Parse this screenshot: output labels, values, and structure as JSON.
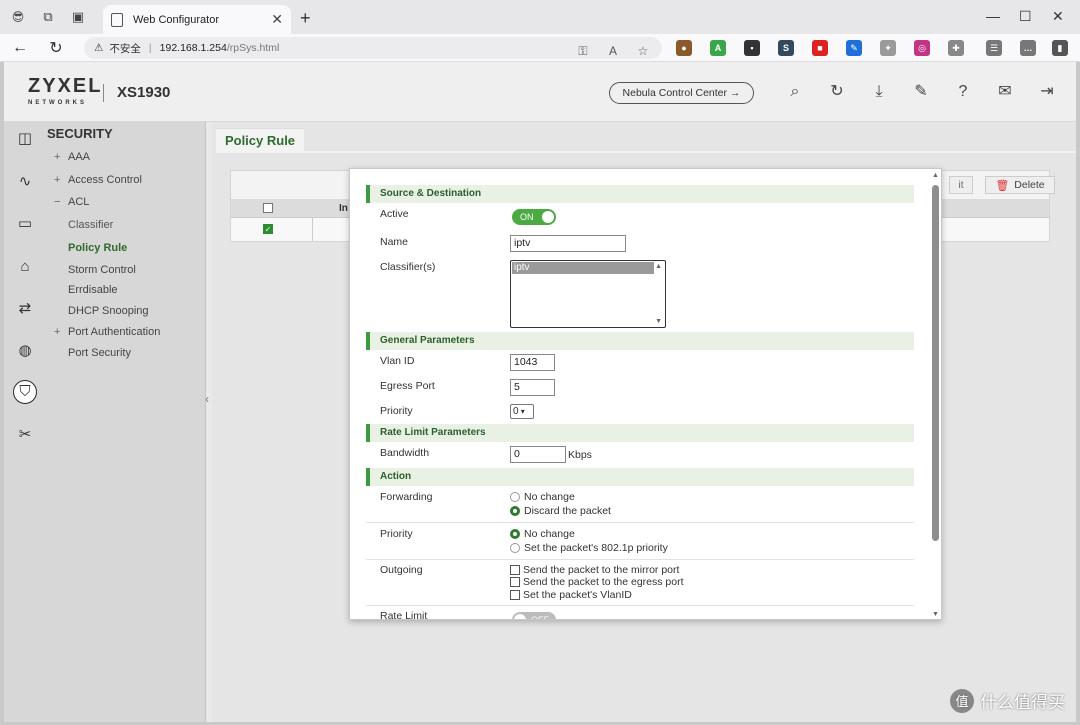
{
  "browser": {
    "tab_title": "Web Configurator",
    "security_warning": "不安全",
    "url_host": "192.168.1.254",
    "url_path": "/rpSys.html"
  },
  "header": {
    "brand": "ZYXEL",
    "brand_sub": "NETWORKS",
    "model": "XS1930",
    "nebula_label": "Nebula Control Center →"
  },
  "menu": {
    "title": "SECURITY",
    "items": [
      {
        "prefix": "+",
        "label": "AAA"
      },
      {
        "prefix": "+",
        "label": "Access Control"
      },
      {
        "prefix": "−",
        "label": "ACL"
      },
      {
        "prefix": "",
        "label": "Classifier"
      },
      {
        "prefix": "",
        "label": "Policy Rule"
      },
      {
        "prefix": "",
        "label": "Storm Control"
      },
      {
        "prefix": "",
        "label": "Errdisable"
      },
      {
        "prefix": "",
        "label": "DHCP Snooping"
      },
      {
        "prefix": "+",
        "label": "Port Authentication"
      },
      {
        "prefix": "",
        "label": "Port Security"
      }
    ]
  },
  "page": {
    "tab": "Policy Rule",
    "edit_label": "it",
    "delete_label": "Delete",
    "index_header": "In"
  },
  "modal": {
    "sections": {
      "source": "Source & Destination",
      "general": "General Parameters",
      "rate": "Rate Limit Parameters",
      "action": "Action"
    },
    "active_label": "Active",
    "active_state": "ON",
    "name_label": "Name",
    "name_value": "iptv",
    "classifier_label": "Classifier(s)",
    "classifier_option": "iptv",
    "vlan_label": "Vlan ID",
    "vlan_value": "1043",
    "egress_label": "Egress Port",
    "egress_value": "5",
    "priority_label": "Priority",
    "priority_value": "0",
    "bandwidth_label": "Bandwidth",
    "bandwidth_value": "0",
    "bandwidth_unit": "Kbps",
    "forwarding_label": "Forwarding",
    "forwarding_opt1": "No change",
    "forwarding_opt2": "Discard the packet",
    "action_priority_label": "Priority",
    "priority_opt1": "No change",
    "priority_opt2": "Set the packet's 802.1p priority",
    "outgoing_label": "Outgoing",
    "outgoing_opt1": "Send the packet to the mirror port",
    "outgoing_opt2": "Send the packet to the egress port",
    "outgoing_opt3": "Set the packet's VlanID",
    "ratelimit_label": "Rate Limit",
    "ratelimit_state": "OFF"
  },
  "watermark": {
    "icon": "值",
    "text": "什么值得买"
  },
  "colors": {
    "accent_green": "#3e9a3e",
    "toggle_on": "#4caa42",
    "delete_red": "#d33"
  }
}
